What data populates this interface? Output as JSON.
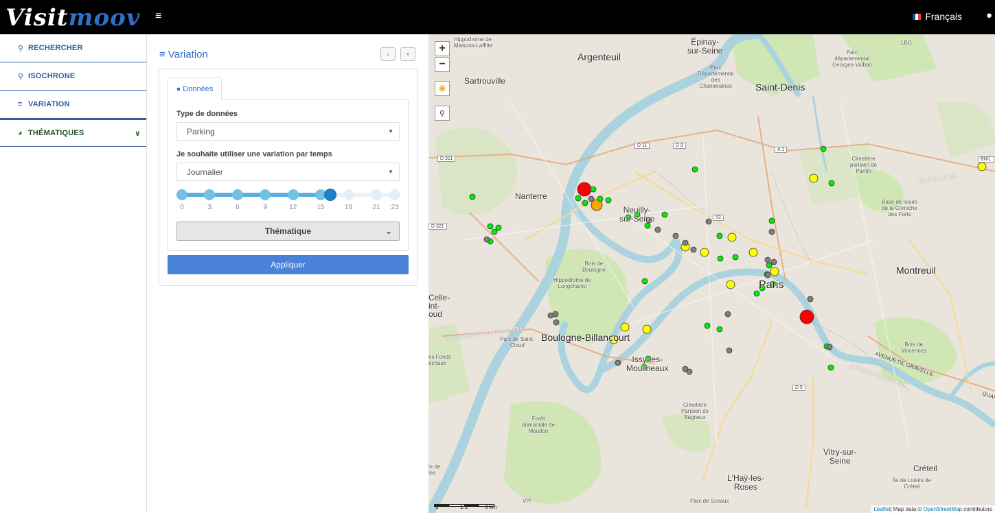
{
  "app": {
    "logo_part1": "Visit",
    "logo_part2": "moov"
  },
  "header": {
    "menu_icon": "≡",
    "language": "Français",
    "language_flag": "flag-fr-icon"
  },
  "sidebar": {
    "items": [
      {
        "label": "RECHERCHER",
        "icon": "search-icon"
      },
      {
        "label": "ISOCHRONE",
        "icon": "search-icon"
      },
      {
        "label": "VARIATION",
        "icon": "sliders-icon"
      },
      {
        "label": "THÉMATIQUES",
        "icon": "pie-chart-icon"
      }
    ]
  },
  "panel": {
    "title": "Variation",
    "tab_label": "Données",
    "type_label": "Type de données",
    "type_value": "Parking",
    "variation_label": "Je souhaite utiliser une variation par temps",
    "variation_value": "Journalier",
    "slider": {
      "min": 0,
      "max": 23,
      "value": 16,
      "ticks": [
        "0",
        "3",
        "6",
        "9",
        "12",
        "15",
        "18",
        "21",
        "23"
      ]
    },
    "thematique_label": "Thématique",
    "apply_label": "Appliquer"
  },
  "map": {
    "zoom_in": "+",
    "zoom_out": "−",
    "attribution_leaflet": "Leaflet",
    "attribution_text": "| Map data © ",
    "attribution_osm": "OpenStreetMap",
    "attribution_tail": " contributors",
    "scale_labels": [
      "0",
      "1.5",
      "3 km"
    ],
    "places": {
      "argenteuil": "Argenteuil",
      "epinay": "Épinay-\nsur-Seine",
      "saint_denis": "Saint-Denis",
      "sartrouville": "Sartrouville",
      "nanterre": "Nanterre",
      "neuilly": "Neuilly-\nsur-Seine",
      "paris": "Paris",
      "montreuil": "Montreuil",
      "boulogne": "Boulogne-Billancourt",
      "issy": "Issy-les-\nMoulineaux",
      "vitry": "Vitry-sur-\nSeine",
      "creteil": "Créteil",
      "lhay": "L'Haÿ-les-\nRoses",
      "celle": "Celle-\nint-\noud",
      "hippodrome_maisons": "Hippodrome de\nMaisons-Laffitte",
      "parc_valbon": "Parc\ndépartemental\nGeorges-Valbon",
      "parc_chanteraines": "Parc\nDépartemental\ndes\nChanteraines",
      "cimetiere_pantin": "Cimetière\nparisien de\nPantin",
      "base_loisirs": "Base de loisirs\nde la Corniche\ndes Forts",
      "bois_boulogne": "Bois de\nBoulogne",
      "hippodrome_longchamp": "Hippodrome de\nLongchamp",
      "bois_vincennes": "Bois de\nVincennes",
      "parc_saint_cloud": "Parc de Saint-\nCloud",
      "fonds_chaux": "es Fonds\néchaux",
      "foret_meudon": "Forêt\ndomaniale de\nMeudon",
      "cimetiere_bagneux": "Cimetière\nParisien de\nBagneux",
      "parc_sceaux": "Parc de Sceaux",
      "ile_loisirs_creteil": "Île de Loisirs de\nCréteil",
      "lbg": "LBG",
      "viy": "VIY",
      "le_de": "le de\nles"
    },
    "road_labels": [
      "D 311",
      "D 321",
      "D 11",
      "D 9",
      "A 1",
      "53",
      "D 5",
      "BNIL"
    ],
    "road_texts": [
      "AUTOROUTE DE NORMANDIE",
      "RUE DE PARIS",
      "AVENUE DE GRAVELLE",
      "AUTOROUTE DE L'EST",
      "QUAI"
    ],
    "markers": [
      {
        "color": "red",
        "size": "large"
      },
      {
        "color": "red",
        "size": "large"
      },
      {
        "color": "orange",
        "size": "medium"
      },
      {
        "color": "yellow",
        "size": "medium"
      },
      {
        "color": "green",
        "size": "small"
      },
      {
        "color": "grey",
        "size": "small"
      }
    ],
    "marker_colors": {
      "red": "#ff0000",
      "orange": "#ffa500",
      "yellow": "#ffff00",
      "green": "#00ee00",
      "grey": "#808080"
    }
  }
}
